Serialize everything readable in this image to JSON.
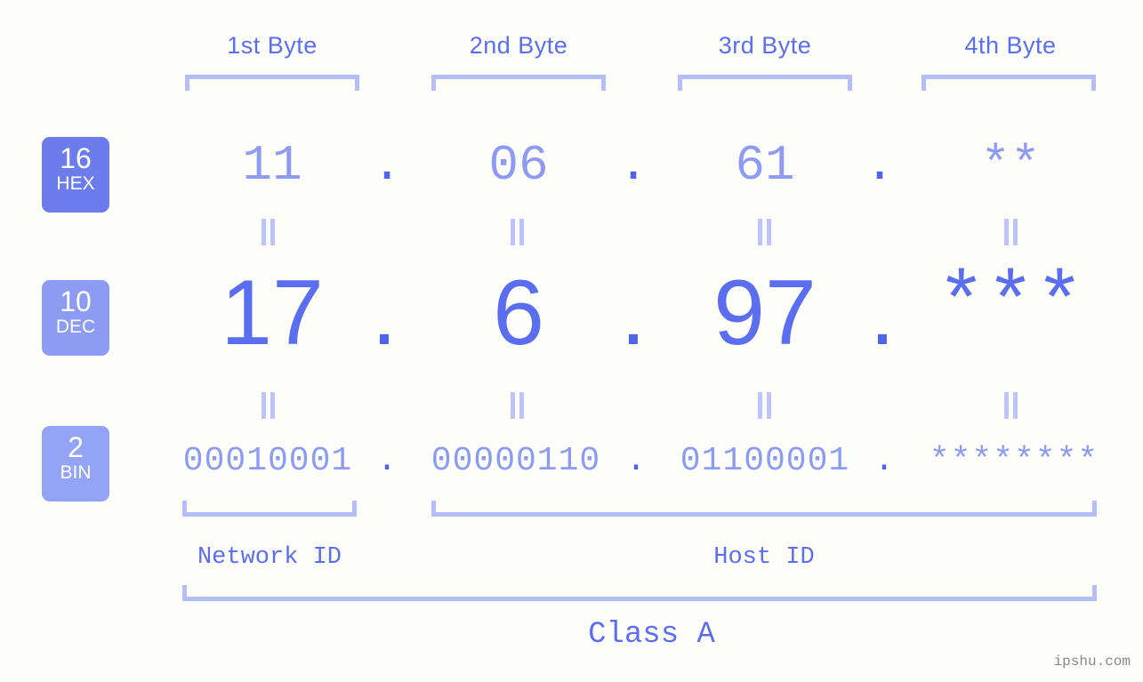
{
  "bases": [
    {
      "number": "16",
      "name": "HEX",
      "color": "#6c7ced"
    },
    {
      "number": "10",
      "name": "DEC",
      "color": "#8d9bf3"
    },
    {
      "number": "2",
      "name": "BIN",
      "color": "#93a4f7"
    }
  ],
  "byte_headers": [
    {
      "label": "1st Byte"
    },
    {
      "label": "2nd Byte"
    },
    {
      "label": "3rd Byte"
    },
    {
      "label": "4th Byte"
    }
  ],
  "rows": {
    "hex": {
      "base": "16",
      "base_name": "HEX",
      "values": [
        "11",
        "06",
        "61",
        "**"
      ],
      "separator": "."
    },
    "dec": {
      "base": "10",
      "base_name": "DEC",
      "values": [
        "17",
        "6",
        "97",
        "***"
      ],
      "separator": "."
    },
    "bin": {
      "base": "2",
      "base_name": "BIN",
      "values": [
        "00010001",
        "00000110",
        "01100001",
        "********"
      ],
      "separator": "."
    }
  },
  "equals_symbol": "=",
  "id_sections": [
    {
      "label": "Network ID"
    },
    {
      "label": "Host ID"
    }
  ],
  "class_label": "Class A",
  "watermark": "ipshu.com",
  "colors": {
    "background": "#fdfefa",
    "accent_strong": "#4e63ee",
    "accent": "#5b6ef0",
    "accent_light": "#8d9bf3",
    "bracket": "#b6bdfb",
    "connector": "#bcc4fb",
    "watermark": "#8a8a8a"
  }
}
